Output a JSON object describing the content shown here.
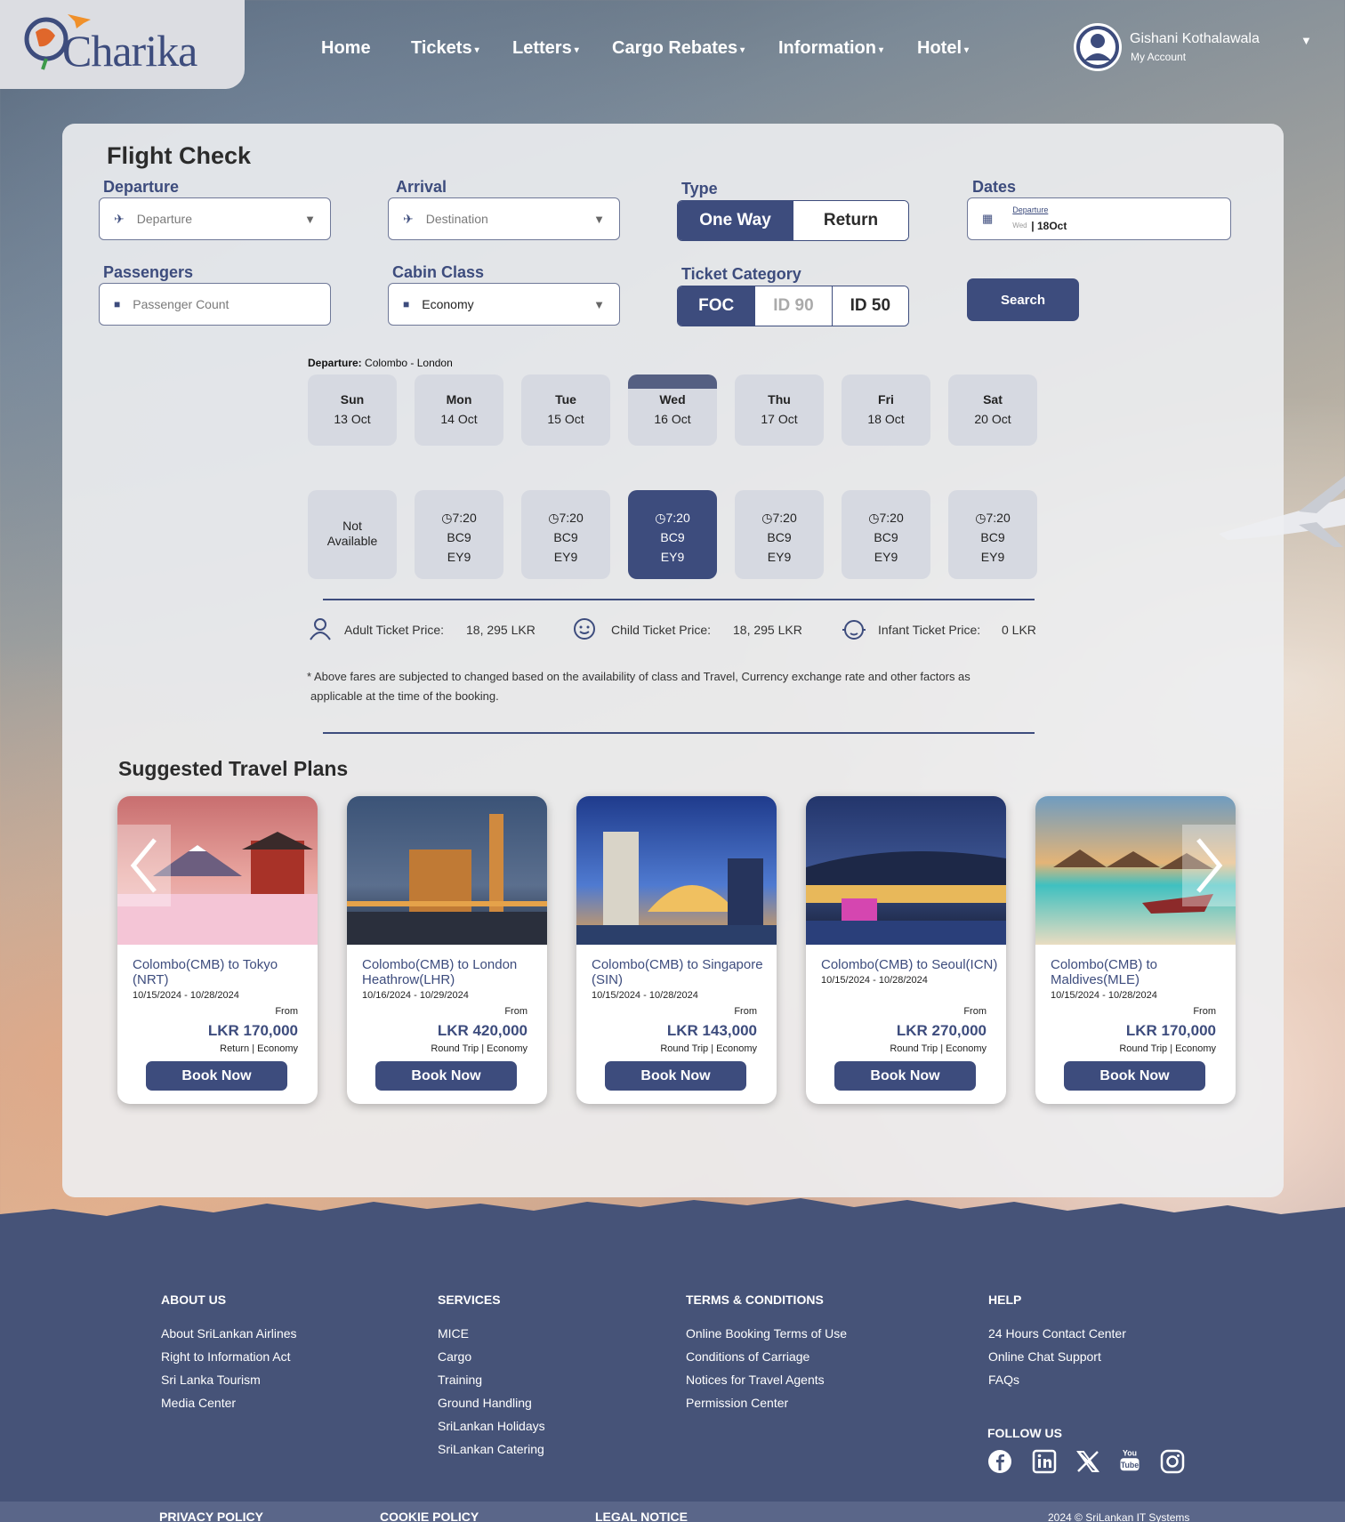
{
  "brand": {
    "logo_text": "Charika"
  },
  "nav": {
    "items": [
      {
        "label": "Home",
        "caret": ""
      },
      {
        "label": "Tickets",
        "caret": "▾"
      },
      {
        "label": "Letters",
        "caret": "▾"
      },
      {
        "label": "Cargo Rebates",
        "caret": "▾"
      },
      {
        "label": "Information",
        "caret": "▾"
      },
      {
        "label": "Hotel",
        "caret": "▾"
      }
    ]
  },
  "user": {
    "name": "Gishani Kothalawala",
    "sub": "My Account",
    "caret": "▼"
  },
  "flight_check": {
    "title": "Flight Check",
    "departure": {
      "label": "Departure",
      "placeholder": "Departure"
    },
    "arrival": {
      "label": "Arrival",
      "placeholder": "Destination"
    },
    "type": {
      "label": "Type",
      "options": [
        "One Way",
        "Return"
      ],
      "selected": "One Way"
    },
    "dates": {
      "label": "Dates",
      "sub_label": "Departure",
      "day": "Wed",
      "date": "18Oct"
    },
    "passengers": {
      "label": "Passengers",
      "placeholder": "Passenger Count"
    },
    "cabin": {
      "label": "Cabin Class",
      "value": "Economy"
    },
    "ticket_category": {
      "label": "Ticket Category",
      "options": [
        "FOC",
        "ID 90",
        "ID 50"
      ],
      "selected": "FOC"
    },
    "search_label": "Search"
  },
  "route": {
    "label": "Departure:",
    "value": "Colombo - London"
  },
  "days": [
    {
      "day": "Sun",
      "date": "13 Oct"
    },
    {
      "day": "Mon",
      "date": "14 Oct"
    },
    {
      "day": "Tue",
      "date": "15 Oct"
    },
    {
      "day": "Wed",
      "date": "16 Oct"
    },
    {
      "day": "Thu",
      "date": "17 Oct"
    },
    {
      "day": "Fri",
      "date": "18 Oct"
    },
    {
      "day": "Sat",
      "date": "20 Oct"
    }
  ],
  "flights": [
    {
      "line1": "Not",
      "line2": "Available",
      "line3": ""
    },
    {
      "time": "7:20",
      "line2": "BC9",
      "line3": "EY9"
    },
    {
      "time": "7:20",
      "line2": "BC9",
      "line3": "EY9"
    },
    {
      "time": "7:20",
      "line2": "BC9",
      "line3": "EY9"
    },
    {
      "time": "7:20",
      "line2": "BC9",
      "line3": "EY9"
    },
    {
      "time": "7:20",
      "line2": "BC9",
      "line3": "EY9"
    },
    {
      "time": "7:20",
      "line2": "BC9",
      "line3": "EY9"
    }
  ],
  "prices": {
    "adult_label": "Adult Ticket Price:",
    "adult_value": "18, 295 LKR",
    "child_label": "Child Ticket Price:",
    "child_value": "18, 295 LKR",
    "infant_label": "Infant Ticket Price:",
    "infant_value": "0 LKR"
  },
  "disclaimer_1": "* Above fares are subjected to changed based on the  availability of class and Travel, Currency exchange rate and other factors as",
  "disclaimer_2": "applicable at the time of the booking.",
  "suggested": {
    "title": "Suggested Travel Plans",
    "cards": [
      {
        "title": "Colombo(CMB) to Tokyo (NRT)",
        "dates": "10/15/2024 - 10/28/2024",
        "from": "From",
        "price": "LKR 170,000",
        "trip": "Return",
        "cls": "Economy",
        "book": "Book Now"
      },
      {
        "title": "Colombo(CMB) to London Heathrow(LHR)",
        "dates": "10/16/2024 - 10/29/2024",
        "from": "From",
        "price": "LKR 420,000",
        "trip": "Round Trip",
        "cls": "Economy",
        "book": "Book Now"
      },
      {
        "title": "Colombo(CMB) to Singapore (SIN)",
        "dates": "10/15/2024 - 10/28/2024",
        "from": "From",
        "price": "LKR 143,000",
        "trip": "Round Trip",
        "cls": "Economy",
        "book": "Book Now"
      },
      {
        "title": "Colombo(CMB) to Seoul(ICN)",
        "dates": "10/15/2024 - 10/28/2024",
        "from": "From",
        "price": "LKR 270,000",
        "trip": "Round Trip",
        "cls": "Economy",
        "book": "Book Now"
      },
      {
        "title": "Colombo(CMB) to Maldives(MLE)",
        "dates": "10/15/2024 - 10/28/2024",
        "from": "From",
        "price": "LKR 170,000",
        "trip": "Round Trip",
        "cls": "Economy",
        "book": "Book Now"
      }
    ]
  },
  "footer": {
    "about": {
      "title": "ABOUT US",
      "items": [
        "About SriLankan Airlines",
        "Right to Information Act",
        "Sri Lanka Tourism",
        "Media Center"
      ]
    },
    "services": {
      "title": "SERVICES",
      "items": [
        "MICE",
        "Cargo",
        "Training",
        "Ground Handling",
        "SriLankan Holidays",
        "SriLankan Catering"
      ]
    },
    "terms": {
      "title": "TERMS & CONDITIONS",
      "items": [
        "Online Booking Terms of Use",
        "Conditions of Carriage",
        "Notices for Travel Agents",
        "Permission Center"
      ]
    },
    "help": {
      "title": "HELP",
      "items": [
        "24 Hours Contact Center",
        "Online Chat Support",
        "FAQs"
      ]
    },
    "follow": "FOLLOW US",
    "social": [
      "facebook-icon",
      "linkedin-icon",
      "x-icon",
      "youtube-icon",
      "instagram-icon"
    ],
    "bottom": {
      "privacy": "PRIVACY POLICY",
      "cookie": "COOKIE POLICY",
      "legal": "LEGAL NOTICE",
      "copyright": "2024 © SriLankan IT Systems"
    }
  },
  "colors": {
    "accent": "#3d4c7d",
    "footer": "#465378",
    "plane": "#f0902a"
  }
}
